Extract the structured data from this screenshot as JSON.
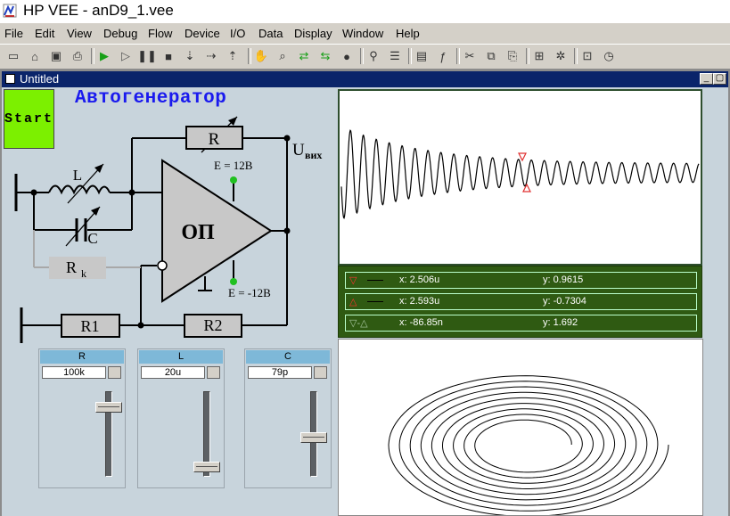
{
  "app": {
    "title": "HP VEE - anD9_1.vee"
  },
  "menu": [
    "File",
    "Edit",
    "View",
    "Debug",
    "Flow",
    "Device",
    "I/O",
    "Data",
    "Display",
    "Window",
    "Help"
  ],
  "toolbar_icons": [
    "new-icon",
    "open-icon",
    "save-icon",
    "print-icon",
    "run-icon",
    "step-icon",
    "pause-icon",
    "stop-icon",
    "step-into-icon",
    "step-over-icon",
    "step-out-icon",
    "hand-icon",
    "probe-icon",
    "data-flow-icon",
    "execution-flow-icon",
    "breakpoint-icon",
    "find-icon",
    "properties-icon",
    "function-icon",
    "cut-icon",
    "copy-icon",
    "paste-icon",
    "line-probe-icon",
    "clean-up-icon",
    "panel-view-icon",
    "timer-icon"
  ],
  "window": {
    "title": "Untitled"
  },
  "panel": {
    "start_label": "Start",
    "heading": "Автогенератор",
    "circuit": {
      "r_label": "R",
      "l_label": "L",
      "c_label": "C",
      "rk_label": "R",
      "rk_sub": "k",
      "opamp_label": "ОП",
      "r1_label": "R1",
      "r2_label": "R2",
      "vplus_label": "E = 12В",
      "vminus_label": "E = -12В",
      "out_label": "U",
      "out_sub": "вих"
    }
  },
  "readouts": [
    {
      "marker": "▽",
      "marker_color": "#ff3030",
      "x": "x: 2.506u",
      "y": "y: 0.9615"
    },
    {
      "marker": "△",
      "marker_color": "#ff3030",
      "x": "x: 2.593u",
      "y": "y: -0.7304"
    },
    {
      "marker": "▽-△",
      "marker_color": "#a8c8a0",
      "x": "x: -86.85n",
      "y": "y: 1.692"
    }
  ],
  "sliders": [
    {
      "title": "R",
      "value": "100k",
      "position": 0.85
    },
    {
      "title": "L",
      "value": "20u",
      "position": 0.0
    },
    {
      "title": "C",
      "value": "79p",
      "position": 0.5
    }
  ],
  "colors": {
    "start": "#7cf000",
    "heading": "#1a1aee",
    "readout_bg": "#2f5a12",
    "slider_title": "#7eb8d8"
  }
}
